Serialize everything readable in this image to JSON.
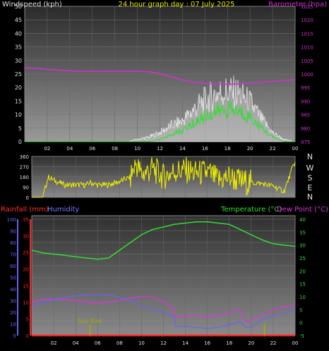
{
  "page_title": "24 hour graph day : 07 July 2025",
  "colors": {
    "wind_speed": "#ffffff",
    "wind_gust_fill": "#c8c8c8",
    "wind_avg": "#33dd33",
    "barometer": "#cc33cc",
    "direction": "#eeee00",
    "temperature": "#33dd33",
    "dew_point": "#dd33dd",
    "humidity": "#6666ee",
    "rainfall": "#ff2020",
    "sun_marker": "#aaaa00",
    "label_yellow": "#e8e800",
    "label_white": "#e0e0e0"
  },
  "panels": {
    "wind": {
      "left_label": "Windspeed (kph)",
      "right_label": "Barometer (hpa)"
    },
    "direction": {
      "compass": [
        "N",
        "W",
        "S",
        "E",
        "N"
      ]
    },
    "temp": {
      "rain_label": "Rainfall (mm)",
      "hum_label": "Humidity",
      "temp_label": "Temperature (°C)",
      "dew_label": "Dew Point (°C)",
      "sunrise_label": "Sun Rise"
    }
  },
  "chart_data": [
    {
      "type": "line",
      "title": "24 hour graph day : 07 July 2025",
      "xlabel": "",
      "x_ticks": [
        "02",
        "04",
        "06",
        "08",
        "10",
        "12",
        "14",
        "16",
        "18",
        "20",
        "22",
        "00"
      ],
      "ylabel": "Windspeed (kph)",
      "ylim": [
        0,
        50
      ],
      "y_ticks": [
        0,
        5,
        10,
        15,
        20,
        25,
        30,
        35,
        40,
        45,
        50
      ],
      "y2label": "Barometer (hpa)",
      "y2lim": [
        975,
        1025
      ],
      "y2_ticks": [
        975,
        980,
        985,
        990,
        995,
        1000,
        1005,
        1010,
        1015,
        1020,
        1025
      ],
      "series": [
        {
          "name": "Barometer",
          "axis": "right",
          "x": [
            0,
            1,
            2,
            3,
            4,
            5,
            6,
            7,
            8,
            9,
            10,
            11,
            12,
            13,
            14,
            15,
            16,
            17,
            18,
            19,
            20,
            21,
            22,
            23,
            24
          ],
          "values": [
            1002.3,
            1002.1,
            1001.7,
            1001.4,
            1001.2,
            1001.0,
            1001.0,
            1001.0,
            1001.1,
            1001.1,
            1001.0,
            1000.8,
            1000.2,
            999.0,
            997.8,
            997.0,
            996.6,
            996.3,
            996.2,
            996.3,
            996.6,
            996.9,
            997.3,
            997.6,
            997.9
          ]
        },
        {
          "name": "Wind gust",
          "axis": "left",
          "x": [
            0,
            1,
            2,
            3,
            4,
            5,
            6,
            7,
            8,
            9,
            10,
            11,
            12,
            13,
            14,
            15,
            16,
            17,
            18,
            19,
            20,
            21,
            22,
            23,
            24
          ],
          "values": [
            0,
            0,
            0,
            0,
            0,
            0,
            0,
            0,
            0,
            0,
            1,
            2,
            4,
            7,
            9,
            14,
            18,
            21,
            22,
            21,
            17,
            10,
            4,
            1,
            0
          ]
        },
        {
          "name": "Wind average",
          "axis": "left",
          "x": [
            0,
            1,
            2,
            3,
            4,
            5,
            6,
            7,
            8,
            9,
            10,
            11,
            12,
            13,
            14,
            15,
            16,
            17,
            18,
            19,
            20,
            21,
            22,
            23,
            24
          ],
          "values": [
            0,
            0,
            0,
            0,
            0,
            0,
            0,
            0,
            0,
            0,
            0,
            0,
            1,
            3,
            5,
            8,
            11,
            13,
            14,
            13,
            11,
            6,
            2,
            0,
            0
          ]
        }
      ]
    },
    {
      "type": "line",
      "title": "",
      "xlabel": "",
      "ylabel": "",
      "ylim": [
        0,
        360
      ],
      "y_ticks": [
        0,
        90,
        180,
        270,
        360
      ],
      "series": [
        {
          "name": "Wind direction",
          "x": [
            0,
            1,
            1.5,
            2,
            3,
            4,
            5,
            5.3,
            6,
            7,
            8,
            9,
            9.5,
            10,
            11,
            12,
            13,
            14,
            15,
            16,
            17,
            18,
            19,
            20,
            21,
            22,
            23,
            23.9
          ],
          "values": [
            0,
            0,
            180,
            150,
            110,
            110,
            110,
            130,
            110,
            110,
            140,
            180,
            300,
            200,
            250,
            180,
            230,
            240,
            210,
            220,
            150,
            180,
            140,
            130,
            120,
            100,
            50,
            300
          ]
        }
      ]
    },
    {
      "type": "line",
      "title": "",
      "xlabel": "",
      "ylabel": "Rainfall (mm)",
      "ylim": [
        0,
        35
      ],
      "y_ticks": [
        0,
        5,
        10,
        15,
        20,
        25,
        30,
        35
      ],
      "y_humidity_ticks": [
        0,
        10,
        20,
        30,
        40,
        50,
        60,
        70,
        80,
        90,
        100
      ],
      "y2label": "Temperature (°C)",
      "y2lim": [
        -5,
        40
      ],
      "y2_ticks": [
        -5,
        0,
        5,
        10,
        15,
        20,
        25,
        30,
        35,
        40
      ],
      "series": [
        {
          "name": "Temperature",
          "x": [
            0,
            1,
            2,
            3,
            4,
            5,
            6,
            7,
            8,
            9,
            10,
            11,
            12,
            13,
            14,
            15,
            16,
            17,
            18,
            19,
            20,
            21,
            22,
            23,
            24
          ],
          "values": [
            28,
            27,
            26.5,
            26,
            25.5,
            25,
            24.5,
            25,
            28,
            31,
            34,
            36,
            37,
            38,
            38.5,
            39,
            39,
            38.5,
            38,
            36,
            34,
            32,
            30.5,
            30,
            29.5
          ]
        },
        {
          "name": "Dew Point",
          "x": [
            0,
            1,
            2,
            3,
            4,
            5,
            6,
            7,
            8,
            9,
            10,
            11,
            12,
            13,
            13.1,
            14,
            15,
            16,
            17,
            18,
            19,
            19.5,
            20,
            21,
            22,
            23,
            24
          ],
          "values": [
            8,
            9,
            9,
            9,
            8.5,
            8,
            7.5,
            8,
            8.5,
            9.5,
            10,
            10,
            8,
            5,
            2,
            2.5,
            3,
            2,
            3,
            3.5,
            5,
            0,
            1,
            3,
            5,
            6,
            7
          ]
        },
        {
          "name": "Humidity",
          "x": [
            0,
            1,
            2,
            3,
            4,
            5,
            6,
            7,
            8,
            9,
            10,
            11,
            12,
            13,
            13.1,
            14,
            15,
            16,
            17,
            18,
            19,
            19.5,
            20,
            21,
            22,
            23,
            24
          ],
          "values": [
            25,
            28,
            31,
            33,
            34,
            35,
            35,
            35,
            33,
            30,
            26,
            23,
            20,
            16,
            8,
            8,
            7,
            6,
            7,
            9,
            12,
            7,
            7,
            14,
            17,
            19,
            23
          ]
        },
        {
          "name": "Rainfall",
          "x": [
            0,
            24
          ],
          "values": [
            0,
            0
          ]
        }
      ],
      "annotations": [
        {
          "label": "Sun Rise",
          "x": 5.3
        },
        {
          "label": "",
          "x": 21.2
        }
      ]
    }
  ]
}
